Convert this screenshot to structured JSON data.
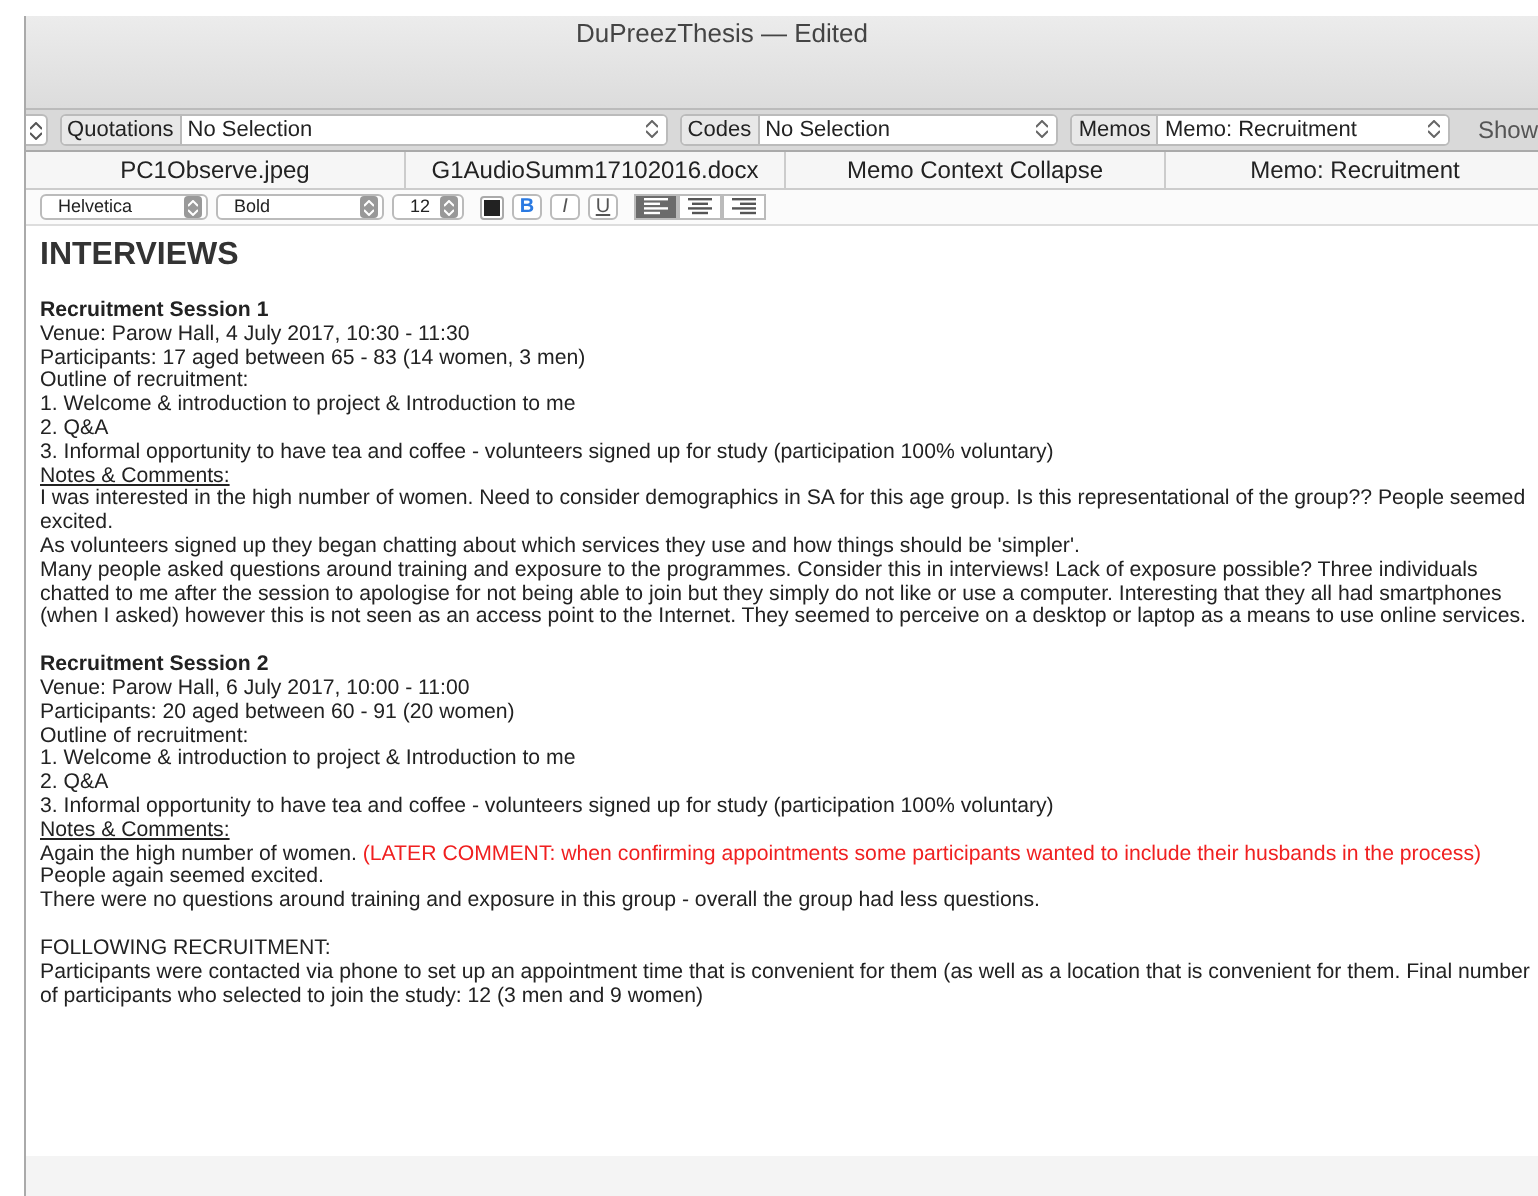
{
  "window": {
    "title": "DuPreezThesis — Edited"
  },
  "toolbar": {
    "filters": [
      {
        "label": "Quotations",
        "value": "No Selection"
      },
      {
        "label": "Codes",
        "value": "No Selection"
      },
      {
        "label": "Memos",
        "value": "Memo: Recruitment"
      }
    ],
    "show_label": "Show"
  },
  "tabs": [
    {
      "label": "PC1Observe.jpeg"
    },
    {
      "label": "G1AudioSumm17102016.docx"
    },
    {
      "label": "Memo Context Collapse"
    },
    {
      "label": "Memo: Recruitment"
    }
  ],
  "format_bar": {
    "font": "Helvetica",
    "style": "Bold",
    "size": "12",
    "styles": [
      {
        "kind": "bold",
        "label": "B",
        "on": true
      },
      {
        "kind": "italic",
        "label": "I",
        "on": false
      },
      {
        "kind": "underline",
        "label": "U",
        "on": false
      }
    ],
    "alignment": [
      {
        "kind": "left",
        "selected": true
      },
      {
        "kind": "center",
        "selected": false
      },
      {
        "kind": "right",
        "selected": false
      }
    ]
  },
  "document": {
    "paragraphs": [
      {
        "kind": "heading",
        "runs": [
          {
            "text": "INTERVIEWS"
          }
        ]
      },
      {
        "kind": "bold",
        "space_before": true,
        "runs": [
          {
            "text": "Recruitment Session 1"
          }
        ]
      },
      {
        "kind": "plain",
        "runs": [
          {
            "text": "Venue: Parow Hall, 4 July 2017, 10:30 - 11:30"
          }
        ]
      },
      {
        "kind": "plain",
        "runs": [
          {
            "text": "Participants: 17 aged between 65 - 83 (14 women, 3 men)"
          }
        ]
      },
      {
        "kind": "plain",
        "runs": [
          {
            "text": "Outline of recruitment:"
          }
        ]
      },
      {
        "kind": "plain",
        "runs": [
          {
            "text": "1. Welcome & introduction to project & Introduction to me"
          }
        ]
      },
      {
        "kind": "plain",
        "runs": [
          {
            "text": "2. Q&A"
          }
        ]
      },
      {
        "kind": "plain",
        "runs": [
          {
            "text": "3. Informal opportunity to have tea and coffee - volunteers signed up for study (participation 100% voluntary)"
          }
        ]
      },
      {
        "kind": "underline",
        "runs": [
          {
            "text": "Notes & Comments:"
          }
        ]
      },
      {
        "kind": "plain",
        "runs": [
          {
            "text": "I was interested in the  high number of women. Need to consider demographics in SA for this age group. Is this representational of the group?? People seemed excited."
          }
        ]
      },
      {
        "kind": "plain",
        "runs": [
          {
            "text": "As volunteers signed up they began chatting about which services they use and how things should be 'simpler'."
          }
        ]
      },
      {
        "kind": "plain",
        "runs": [
          {
            "text": "Many people asked questions around training and exposure to the programmes. Consider this in interviews! Lack of exposure possible? Three individuals chatted to me after the session to apologise for not being able to join but they simply do not like or use a computer. Interesting that they all had smartphones (when I asked) however this is not seen as an access point to the Internet. They seemed to perceive on a desktop or laptop as a means to use online services."
          }
        ]
      },
      {
        "kind": "bold",
        "space_before": true,
        "runs": [
          {
            "text": "Recruitment Session 2"
          }
        ]
      },
      {
        "kind": "plain",
        "runs": [
          {
            "text": "Venue: Parow Hall, 6 July 2017, 10:00 - 11:00"
          }
        ]
      },
      {
        "kind": "plain",
        "runs": [
          {
            "text": "Participants: 20 aged between 60 - 91 (20 women)"
          }
        ]
      },
      {
        "kind": "plain",
        "runs": [
          {
            "text": "Outline of recruitment:"
          }
        ]
      },
      {
        "kind": "plain",
        "runs": [
          {
            "text": "1. Welcome & introduction to project & Introduction to me"
          }
        ]
      },
      {
        "kind": "plain",
        "runs": [
          {
            "text": "2. Q&A"
          }
        ]
      },
      {
        "kind": "plain",
        "runs": [
          {
            "text": "3. Informal opportunity to have tea and coffee - volunteers signed up for study (participation 100% voluntary)"
          }
        ]
      },
      {
        "kind": "underline",
        "runs": [
          {
            "text": "Notes & Comments:"
          }
        ]
      },
      {
        "kind": "plain",
        "runs": [
          {
            "text": "Again the high number of women. "
          },
          {
            "text": "(LATER COMMENT: when confirming appointments some participants wanted to include their husbands in the process)",
            "kind": "comment"
          }
        ]
      },
      {
        "kind": "plain",
        "runs": [
          {
            "text": "People again seemed excited."
          }
        ]
      },
      {
        "kind": "plain",
        "runs": [
          {
            "text": "There were no questions around training and exposure in this group - overall the group had less questions."
          }
        ]
      },
      {
        "kind": "plain",
        "space_before": true,
        "runs": [
          {
            "text": "FOLLOWING RECRUITMENT:"
          }
        ]
      },
      {
        "kind": "plain",
        "runs": [
          {
            "text": "Participants were contacted via phone to set up an appointment time that is convenient for them (as well as a location that is convenient for them. Final number of participants who selected to join the study: 12 (3 men and 9 women)"
          }
        ]
      }
    ]
  }
}
